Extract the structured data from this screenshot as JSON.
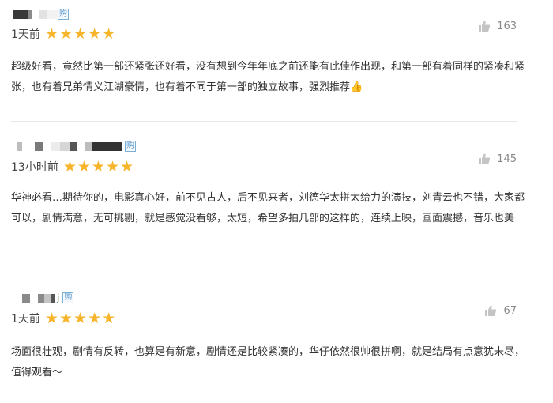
{
  "reviews": [
    {
      "buy_tag": "购",
      "time": "1天前",
      "likes": "163",
      "rating": 5,
      "text": "超级好看，竟然比第一部还紧张还好看，没有想到今年年底之前还能有此佳作出现，和第一部有着同样的紧凑和紧张，也有着兄弟情义江湖豪情，也有着不同于第一部的独立故事，强烈推荐👍"
    },
    {
      "buy_tag": "购",
      "time": "13小时前",
      "likes": "145",
      "rating": 5,
      "text": "华神必看…期待你的，电影真心好，前不见古人，后不见来者，刘德华太拼太给力的演技，刘青云也不错，大家都可以，剧情满意，无可挑剔，就是感觉没看够，太短，希望多拍几部的这样的，连续上映，画面震撼，音乐也美"
    },
    {
      "buy_tag": "购",
      "time": "1天前",
      "likes": "67",
      "rating": 5,
      "text": "场面很壮观，剧情有反转，也算是有新意，剧情还是比较紧凑的，华仔依然很帅很拼啊，就是结局有点意犹未尽，值得观看～"
    }
  ],
  "name_suffix_2": "j",
  "star_glyph": "★",
  "colors": {
    "star": "#f7b52c",
    "buy_tag": "#5b98cc",
    "divider": "#e8e8e8"
  }
}
